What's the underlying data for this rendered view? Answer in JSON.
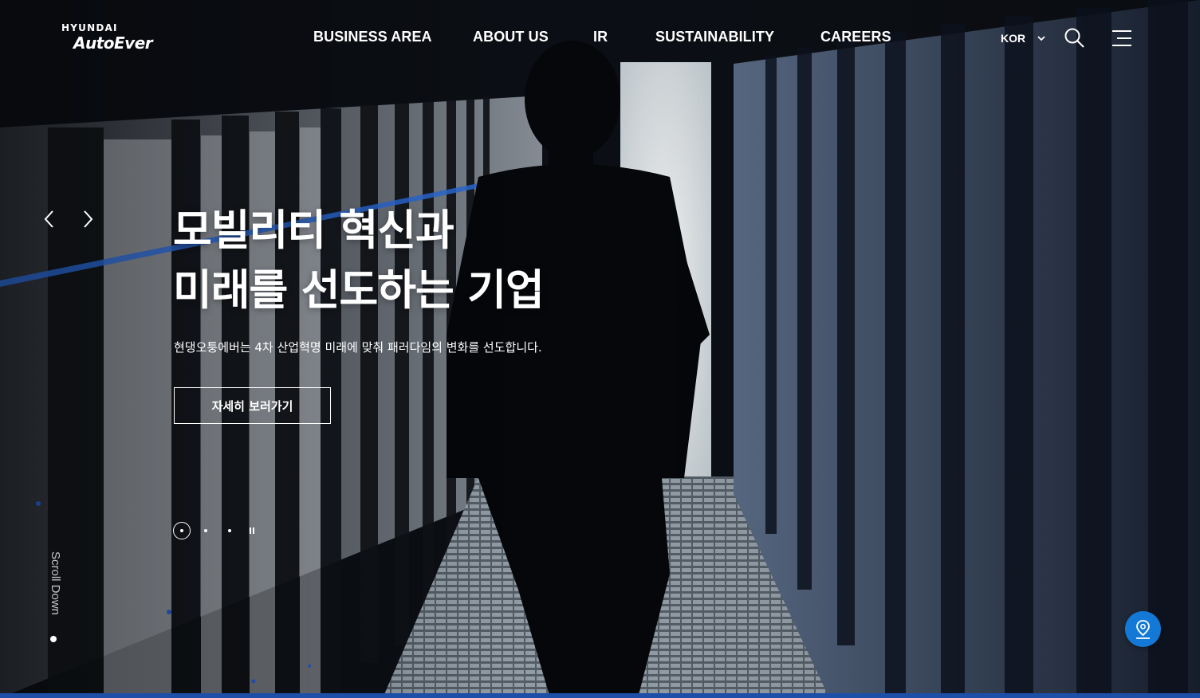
{
  "brand": {
    "line1": "HYUNDAI",
    "line2": "AutoEver"
  },
  "nav": {
    "items": [
      {
        "label": "BUSINESS AREA"
      },
      {
        "label": "ABOUT US"
      },
      {
        "label": "IR"
      },
      {
        "label": "SUSTAINABILITY"
      },
      {
        "label": "CAREERS"
      }
    ],
    "language": "KOR"
  },
  "hero": {
    "headline_line1": "모빌리티 혁신과",
    "headline_line2": "미래를 선도하는 기업",
    "subcopy": "현댕오퉁에버는 4차 산업혁명 미래에 맞춰 패러다임의 변화를 선도합니다.",
    "cta_label": "자세히 보러가기",
    "slides_total": 3,
    "active_slide": 1
  },
  "scroll_label": "Scroll Down",
  "colors": {
    "accent_blue": "#1479d6",
    "bottom_bar": "#1d4fa8",
    "text": "#ffffff"
  },
  "icons": {
    "prev": "chevron-left-icon",
    "next": "chevron-right-icon",
    "language": "chevron-down-icon",
    "search": "search-icon",
    "menu": "menu-icon",
    "location": "location-pin-icon"
  }
}
